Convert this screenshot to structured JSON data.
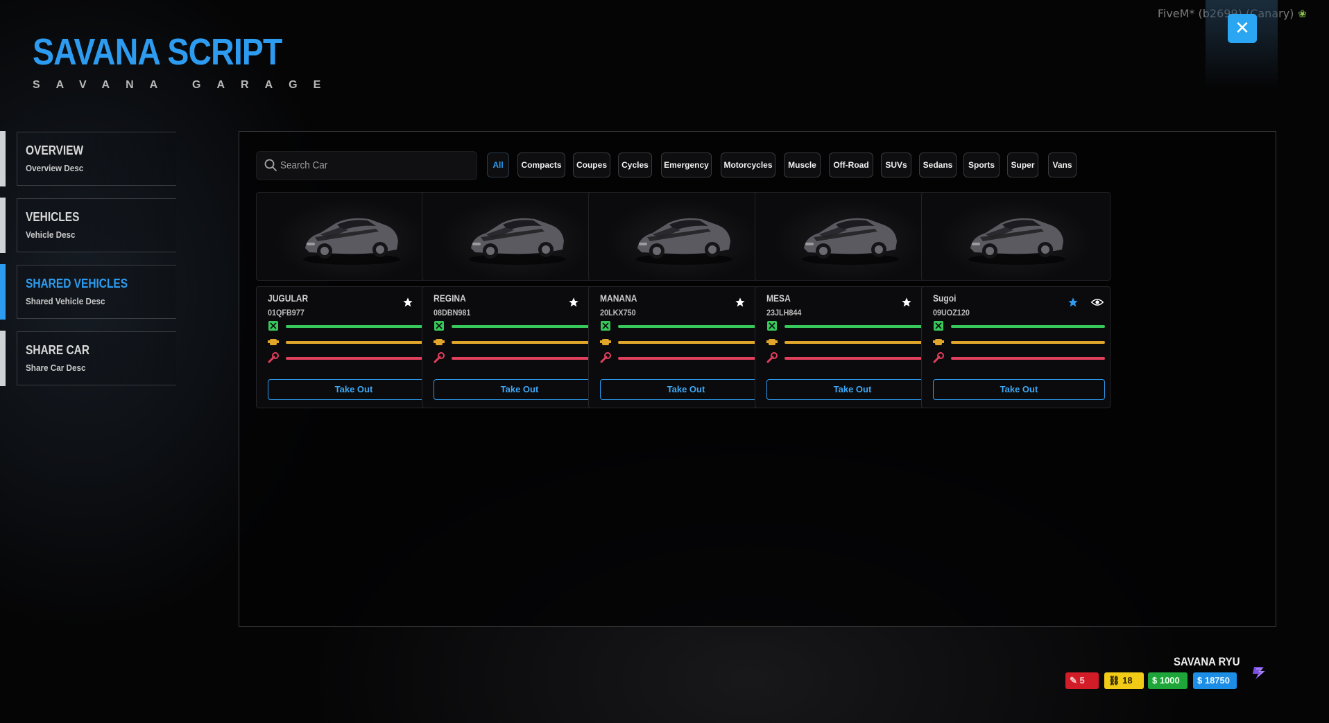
{
  "window": {
    "title": "FiveM* (b2699) (Canary)",
    "icon": "leaf-icon"
  },
  "header": {
    "title": "SAVANA SCRIPT",
    "subtitle": "SAVANA GARAGE",
    "close_icon": "close-icon"
  },
  "sidebar": {
    "items": [
      {
        "title": "OVERVIEW",
        "desc": "Overview Desc",
        "active": false
      },
      {
        "title": "VEHICLES",
        "desc": "Vehicle Desc",
        "active": false
      },
      {
        "title": "SHARED VEHICLES",
        "desc": "Shared Vehicle Desc",
        "active": true
      },
      {
        "title": "SHARE CAR",
        "desc": "Share Car Desc",
        "active": false
      }
    ]
  },
  "search": {
    "placeholder": "Search Car"
  },
  "categories": [
    "All",
    "Compacts",
    "Coupes",
    "Cycles",
    "Emergency",
    "Motorcycles",
    "Muscle",
    "Off-Road",
    "SUVs",
    "Sedans",
    "Sports",
    "Super",
    "Vans"
  ],
  "active_category": "All",
  "vehicles": [
    {
      "name": "JUGULAR",
      "plate": "01QFB977",
      "favorite": false,
      "fuel": 1.0,
      "engine": 1.0,
      "body": 1.0,
      "action": "Take Out"
    },
    {
      "name": "REGINA",
      "plate": "08DBN981",
      "favorite": false,
      "fuel": 1.0,
      "engine": 1.0,
      "body": 1.0,
      "action": "Take Out"
    },
    {
      "name": "MANANA",
      "plate": "20LKX750",
      "favorite": false,
      "fuel": 1.0,
      "engine": 1.0,
      "body": 1.0,
      "action": "Take Out"
    },
    {
      "name": "MESA",
      "plate": "23JLH844",
      "favorite": false,
      "fuel": 1.0,
      "engine": 1.0,
      "body": 1.0,
      "action": "Take Out"
    },
    {
      "name": "Sugoi",
      "plate": "09UOZ120",
      "favorite": true,
      "fuel": 1.0,
      "engine": 1.0,
      "body": 1.0,
      "action": "Take Out"
    }
  ],
  "player": {
    "name": "SAVANA RYU",
    "keys": "5",
    "cars": "18",
    "cash": "$ 1000",
    "bank": "$ 18750"
  },
  "colors": {
    "accent": "#2d9cf0",
    "fuel": "#37c75a",
    "engine": "#e0a52a",
    "body": "#e0405c",
    "favorite": "#2d9cf0"
  }
}
